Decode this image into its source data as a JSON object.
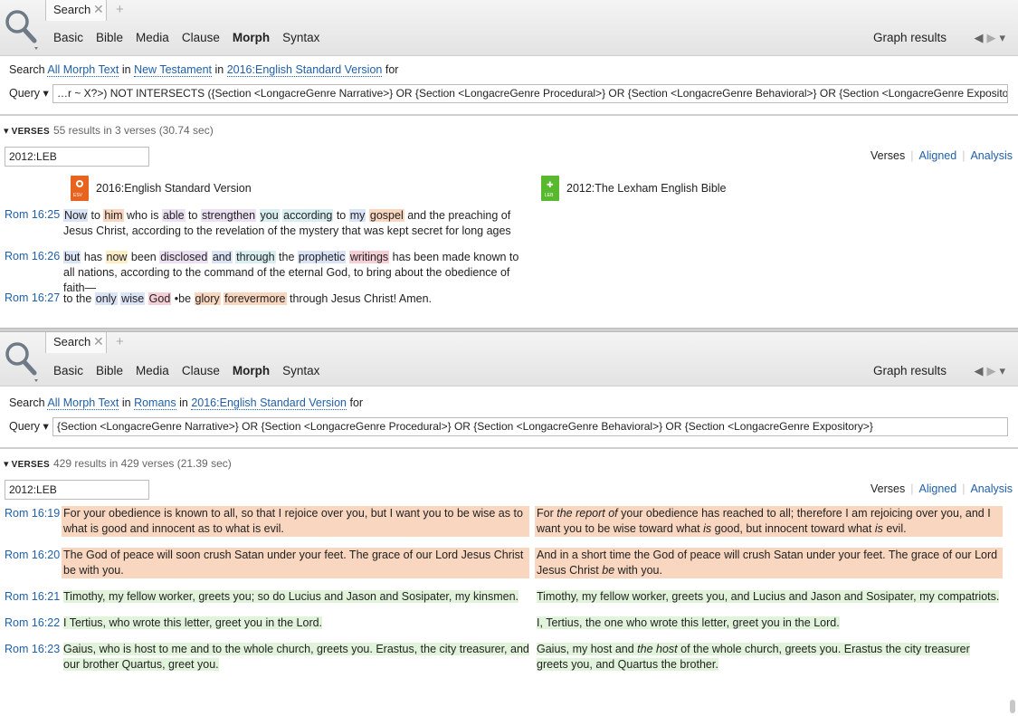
{
  "panel1": {
    "tab_label": "Search",
    "tab_close": "✕",
    "tab_add": "+",
    "modes": [
      "Basic",
      "Bible",
      "Media",
      "Clause",
      "Morph",
      "Syntax"
    ],
    "active_mode": "Morph",
    "graph_results": "Graph results",
    "search": {
      "prefix": "Search",
      "field": "All Morph Text",
      "in1": "in",
      "scope": "New Testament",
      "in2": "in",
      "resource": "2016:English Standard Version",
      "suffix": "for"
    },
    "query_label": "Query",
    "query_text": "…r ~ X?>) NOT INTERSECTS ({Section <LongacreGenre Narrative>} OR {Section <LongacreGenre Procedural>} OR {Section <LongacreGenre Behavioral>} OR {Section <LongacreGenre Expository>})",
    "verses_label": "VERSES",
    "verses_meta": "55 results in 3 verses (30.74 sec)",
    "reference_input": "2012:LEB",
    "view_tabs": {
      "verses": "Verses",
      "aligned": "Aligned",
      "analysis": "Analysis"
    },
    "bible_left": "2016:English Standard Version",
    "bible_right": "2012:The Lexham English Bible",
    "icon_left_label": "ESV",
    "icon_right_label": "LEB",
    "rows": [
      {
        "ref": "Rom 16:25"
      },
      {
        "ref": "Rom 16:26"
      },
      {
        "ref": "Rom 16:27"
      }
    ]
  },
  "panel2": {
    "tab_label": "Search",
    "tab_close": "✕",
    "tab_add": "+",
    "modes": [
      "Basic",
      "Bible",
      "Media",
      "Clause",
      "Morph",
      "Syntax"
    ],
    "active_mode": "Morph",
    "graph_results": "Graph results",
    "search": {
      "prefix": "Search",
      "field": "All Morph Text",
      "in1": "in",
      "scope": "Romans",
      "in2": "in",
      "resource": "2016:English Standard Version",
      "suffix": "for"
    },
    "query_label": "Query",
    "query_text": "{Section <LongacreGenre Narrative>} OR {Section <LongacreGenre Procedural>} OR {Section <LongacreGenre Behavioral>} OR {Section <LongacreGenre Expository>}",
    "verses_label": "VERSES",
    "verses_meta": "429 results in 429 verses (21.39 sec)",
    "reference_input": "2012:LEB",
    "view_tabs": {
      "verses": "Verses",
      "aligned": "Aligned",
      "analysis": "Analysis"
    },
    "rows": [
      {
        "ref": "Rom 16:19",
        "left": "For your obedience is known to all, so that I rejoice over you, but I want you to be wise as to what is good and innocent as to what is evil.",
        "right_html_parts": [
          "For ",
          "the report of",
          " your obedience has reached to all; therefore I am rejoicing over you, and I want you to be wise toward what ",
          "is",
          " good, but innocent toward what ",
          "is",
          " evil."
        ]
      },
      {
        "ref": "Rom 16:20",
        "left": "The God of peace will soon crush Satan under your feet. The grace of our Lord Jesus Christ be with you.",
        "right_html_parts": [
          "And in a short time the God of peace will crush Satan under your feet. The grace of our Lord Jesus Christ ",
          "be",
          " with you."
        ]
      },
      {
        "ref": "Rom 16:21",
        "left": "Timothy, my fellow worker, greets you; so do Lucius and Jason and Sosipater, my kinsmen.",
        "right": "Timothy, my fellow worker, greets you, and Lucius and Jason and Sosipater, my compatriots."
      },
      {
        "ref": "Rom 16:22",
        "left": "I Tertius, who wrote this letter, greet you in the Lord.",
        "right": "I, Tertius, the one who wrote this letter, greet you in the Lord."
      },
      {
        "ref": "Rom 16:23",
        "left": "Gaius, who is host to me and to the whole church, greets you. Erastus, the city treasurer, and our brother Quartus, greet you.",
        "right_html_parts": [
          "Gaius, my host and ",
          "the host",
          " of the whole church, greets you. Erastus the city treasurer greets you, and Quartus the brother."
        ]
      }
    ]
  },
  "colors": {
    "link": "#1f5fa8",
    "highlight_orange": "#f9d6bf",
    "highlight_green": "#e2f3dc",
    "esv_icon": "#e8641e",
    "leb_icon": "#58b82e"
  }
}
